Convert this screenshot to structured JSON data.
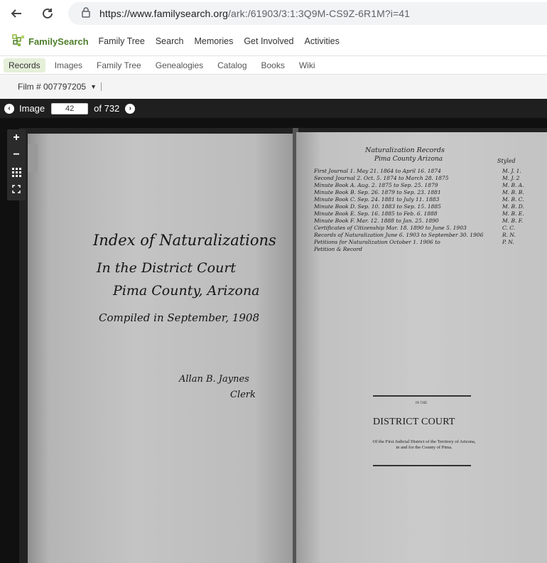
{
  "browser": {
    "url_host": "https://www.familysearch.org",
    "url_path": "/ark:/61903/3:1:3Q9M-CS9Z-6R1M?i=41"
  },
  "header": {
    "logo_text": "FamilySearch",
    "nav": [
      "Family Tree",
      "Search",
      "Memories",
      "Get Involved",
      "Activities"
    ]
  },
  "subnav": {
    "items": [
      "Records",
      "Images",
      "Family Tree",
      "Genealogies",
      "Catalog",
      "Books",
      "Wiki"
    ],
    "active": "Records"
  },
  "film": {
    "label": "Film # 007797205"
  },
  "viewer": {
    "image_label": "Image",
    "image_number": "42",
    "total": "of 732",
    "zoom_in": "+",
    "zoom_out": "−",
    "grid_icon": "grid-icon",
    "fullscreen_icon": "fullscreen-icon"
  },
  "document": {
    "left": {
      "line1": "Index of Naturalizations",
      "line2": "In the District Court",
      "line3": "Pima County, Arizona",
      "line4": "Compiled in September, 1908",
      "sig1": "Allan B. Jaynes",
      "sig2": "Clerk"
    },
    "right": {
      "title": "Naturalization Records",
      "subtitle": "Pima County Arizona",
      "styled_label": "Styled",
      "rows": [
        {
          "text": "First Journal   1.  May 21. 1864  to  April 16. 1874",
          "abbr": "M. J. 1."
        },
        {
          "text": "Second Journal  2.  Oct. 5. 1874  to  March 28. 1875",
          "abbr": "M. J. 2"
        },
        {
          "text": "Minute Book   A.  Aug. 2. 1875  to  Sep. 25. 1879",
          "abbr": "M. B. A."
        },
        {
          "text": "Minute Book   B.  Sep. 26. 1879  to  Sep. 23. 1881",
          "abbr": "M. B. B."
        },
        {
          "text": "Minute Book   C.  Sep. 24. 1881  to  July 11. 1883",
          "abbr": "M. B. C."
        },
        {
          "text": "Minute Book   D.  Sep. 10. 1883  to  Sep. 15. 1885",
          "abbr": "M. B. D."
        },
        {
          "text": "Minute Book   E.  Sep. 16. 1885  to  Feb. 6. 1888",
          "abbr": "M. B. E."
        },
        {
          "text": "Minute Book   F.  Mar. 12. 1888  to  Jan. 25. 1890",
          "abbr": "M. B. F."
        },
        {
          "text": "Certificates of Citizenship  Mar. 18. 1890  to  June 5. 1903",
          "abbr": "C. C."
        },
        {
          "text": "Records of Naturalization  June 6. 1903  to  September 30. 1906",
          "abbr": "R. N."
        },
        {
          "text": "Petitions for Naturalization  October 1. 1906  to",
          "abbr": "P. N."
        },
        {
          "text": "Petition & Record",
          "abbr": ""
        }
      ],
      "court_in": "IN THE",
      "court_title": "DISTRICT COURT",
      "court_text": "Of the First Judicial District of the Territory of Arizona, in and for the County of Pima."
    }
  }
}
